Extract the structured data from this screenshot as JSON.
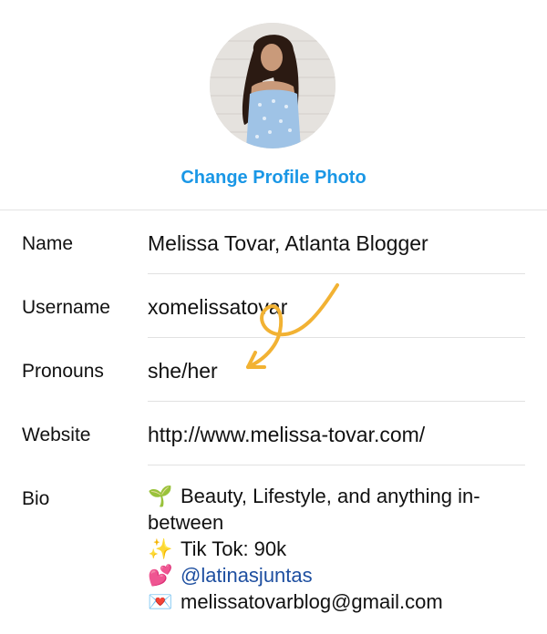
{
  "profile": {
    "change_photo_label": "Change Profile Photo"
  },
  "fields": {
    "name": {
      "label": "Name",
      "value": "Melissa Tovar, Atlanta Blogger"
    },
    "username": {
      "label": "Username",
      "value": "xomelissatovar"
    },
    "pronouns": {
      "label": "Pronouns",
      "value": "she/her"
    },
    "website": {
      "label": "Website",
      "value": "http://www.melissa-tovar.com/"
    },
    "bio": {
      "label": "Bio",
      "lines": [
        {
          "icon": "seedling-icon",
          "emoji": "🌱",
          "text": "Beauty, Lifestyle, and anything in-"
        },
        {
          "icon": "",
          "emoji": "",
          "text": "between"
        },
        {
          "icon": "sparkles-icon",
          "emoji": "✨",
          "text": "Tik Tok: 90k"
        },
        {
          "icon": "hearts-icon",
          "emoji": "💕",
          "text": "@latinasjuntas"
        },
        {
          "icon": "love-letter-icon",
          "emoji": "💌",
          "text": "melissatovarblog@gmail.com"
        }
      ]
    }
  },
  "colors": {
    "link_blue": "#1a97e6",
    "mention_blue": "#1e4fa0",
    "annotation_yellow": "#f2b233"
  }
}
